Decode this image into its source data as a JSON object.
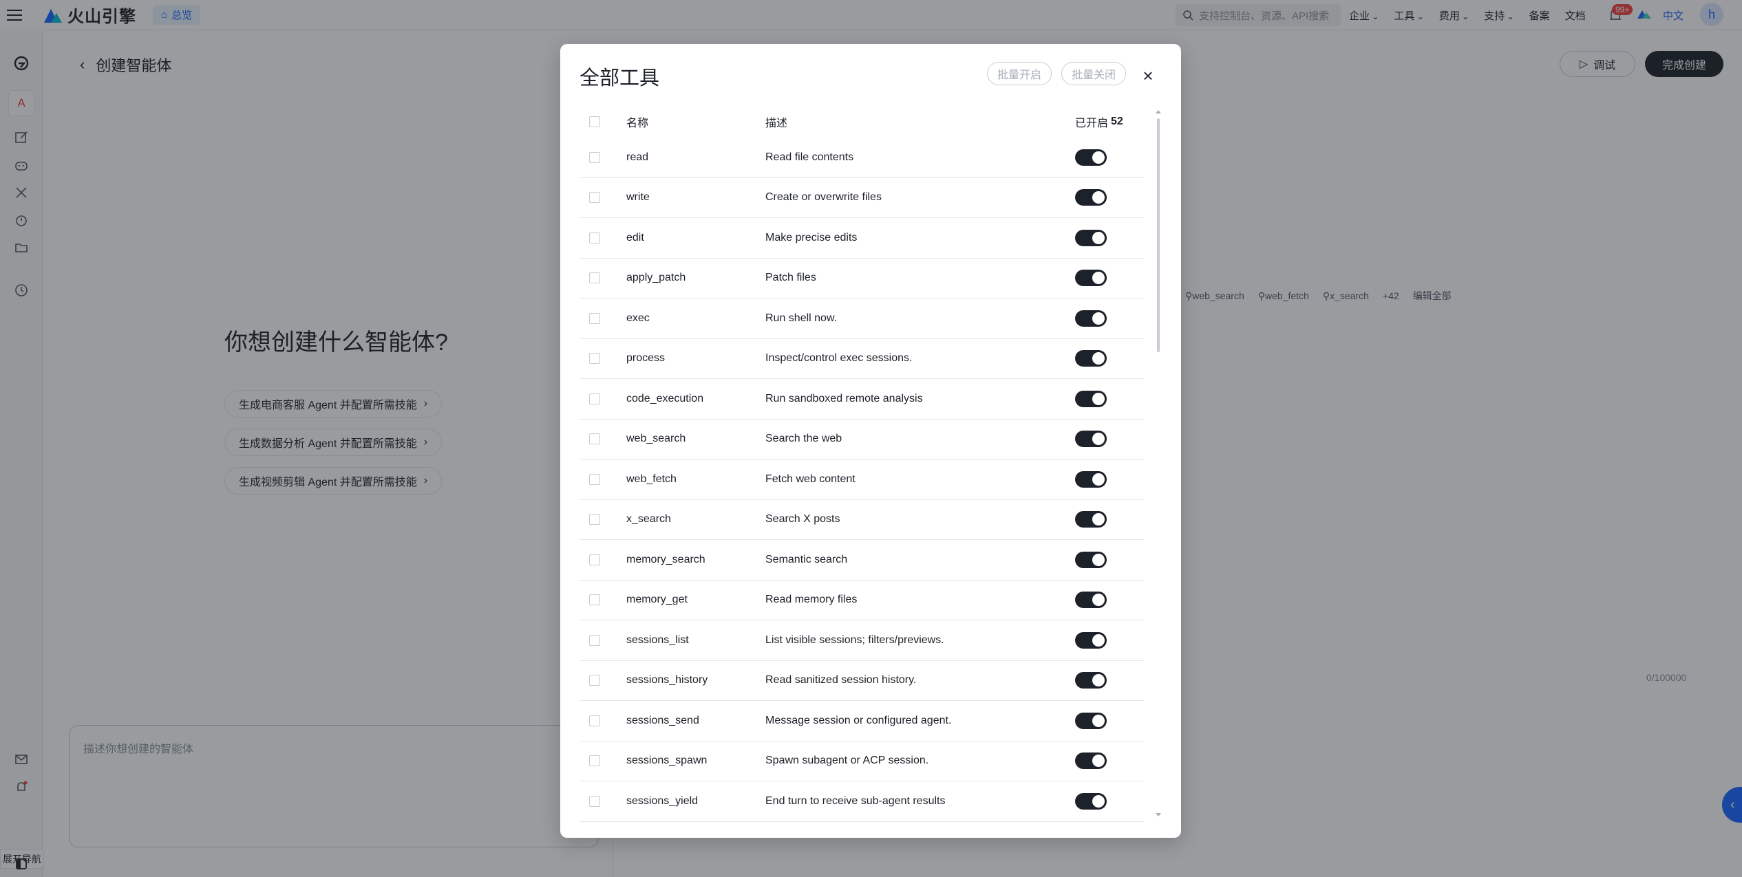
{
  "topbar": {
    "brand": "火山引擎",
    "home_label": "总览",
    "search_placeholder": "支持控制台、资源、API搜索",
    "nav": [
      "企业",
      "工具",
      "费用",
      "支持",
      "备案",
      "文档"
    ],
    "notification_badge": "99+",
    "language": "中文",
    "avatar_letter": "h"
  },
  "sidebar": {
    "avatar_letter": "A",
    "collapse_tooltip": "展开导航",
    "icons": [
      "brand-icon",
      "edit-icon",
      "bot-icon",
      "tools-icon",
      "alarm-icon",
      "folder-icon",
      "history-icon",
      "mail-icon",
      "bell-icon",
      "panel-icon"
    ]
  },
  "page": {
    "title": "创建智能体",
    "debug_label": "调试",
    "finish_label": "完成创建",
    "hero": "你想创建什么智能体?",
    "suggestions": [
      "生成电商客服 Agent 并配置所需技能",
      "生成数据分析 Agent 并配置所需技能",
      "生成视频剪辑 Agent 并配置所需技能"
    ],
    "input_placeholder": "描述你想创建的智能体",
    "tool_chips": [
      "web_search",
      "web_fetch",
      "x_search"
    ],
    "more_count": "+42",
    "edit_all": "编辑全部",
    "char_counter": "0/100000"
  },
  "modal": {
    "title": "全部工具",
    "bulk_enable": "批量开启",
    "bulk_disable": "批量关闭",
    "col_name": "名称",
    "col_desc": "描述",
    "enabled_label": "已开启",
    "enabled_count": "52",
    "tools": [
      {
        "name": "read",
        "desc": "Read file contents",
        "enabled": true
      },
      {
        "name": "write",
        "desc": "Create or overwrite files",
        "enabled": true
      },
      {
        "name": "edit",
        "desc": "Make precise edits",
        "enabled": true
      },
      {
        "name": "apply_patch",
        "desc": "Patch files",
        "enabled": true
      },
      {
        "name": "exec",
        "desc": "Run shell now.",
        "enabled": true
      },
      {
        "name": "process",
        "desc": "Inspect/control exec sessions.",
        "enabled": true
      },
      {
        "name": "code_execution",
        "desc": "Run sandboxed remote analysis",
        "enabled": true
      },
      {
        "name": "web_search",
        "desc": "Search the web",
        "enabled": true
      },
      {
        "name": "web_fetch",
        "desc": "Fetch web content",
        "enabled": true
      },
      {
        "name": "x_search",
        "desc": "Search X posts",
        "enabled": true
      },
      {
        "name": "memory_search",
        "desc": "Semantic search",
        "enabled": true
      },
      {
        "name": "memory_get",
        "desc": "Read memory files",
        "enabled": true
      },
      {
        "name": "sessions_list",
        "desc": "List visible sessions; filters/previews.",
        "enabled": true
      },
      {
        "name": "sessions_history",
        "desc": "Read sanitized session history.",
        "enabled": true
      },
      {
        "name": "sessions_send",
        "desc": "Message session or configured agent.",
        "enabled": true
      },
      {
        "name": "sessions_spawn",
        "desc": "Spawn subagent or ACP session.",
        "enabled": true
      },
      {
        "name": "sessions_yield",
        "desc": "End turn to receive sub-agent results",
        "enabled": true
      }
    ]
  }
}
